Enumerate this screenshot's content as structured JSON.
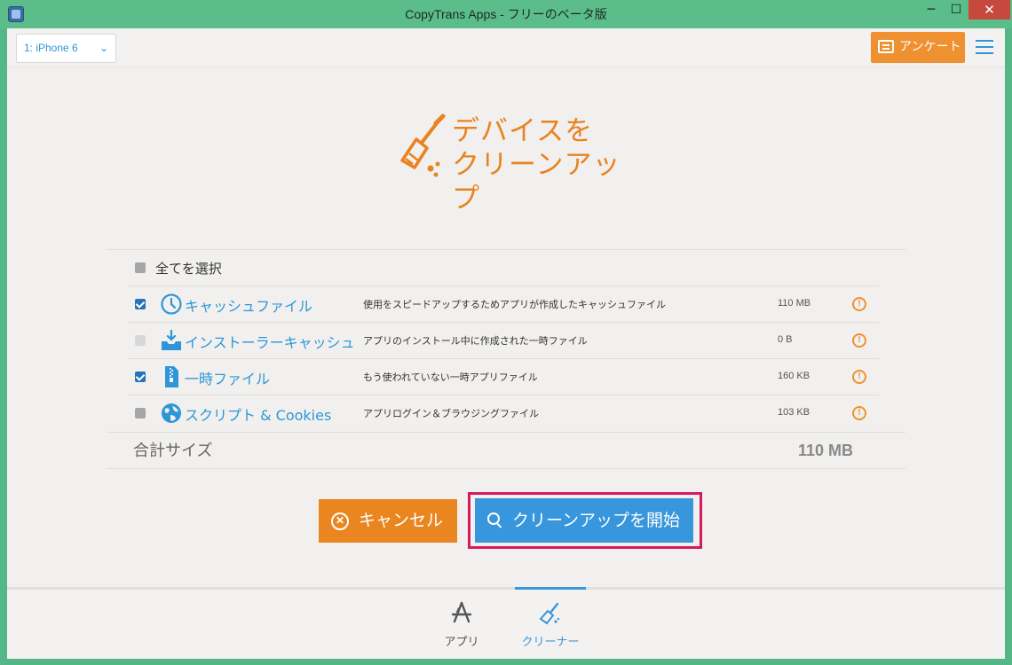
{
  "window": {
    "title": "CopyTrans Apps - フリーのベータ版",
    "minimize": "─",
    "maximize": "☐",
    "close": "✕"
  },
  "header": {
    "device": "1: iPhone 6",
    "survey_label": "アンケート"
  },
  "hero": {
    "line1": "デバイスを",
    "line2": "クリーンアップ"
  },
  "list": {
    "select_all": "全てを選択",
    "rows": [
      {
        "name": "キャッシュファイル",
        "desc": "使用をスピードアップするためアプリが作成したキャッシュファイル",
        "size": "110 MB",
        "checked": true,
        "icon": "clock-icon"
      },
      {
        "name": "インストーラーキャッシュ",
        "desc": "アプリのインストール中に作成された一時ファイル",
        "size": "0 B",
        "checked": false,
        "icon": "inbox-icon"
      },
      {
        "name": "一時ファイル",
        "desc": "もう使われていない一時アプリファイル",
        "size": "160 KB",
        "checked": true,
        "icon": "zip-file-icon"
      },
      {
        "name": "スクリプト & Cookies",
        "desc": "アプリログイン＆ブラウジングファイル",
        "size": "103 KB",
        "checked": false,
        "icon": "globe-icon"
      }
    ],
    "warn_symbol": "!",
    "total_label": "合計サイズ",
    "total_value": "110 MB"
  },
  "actions": {
    "cancel_label": "キャンセル",
    "cancel_symbol": "✕",
    "start_label": "クリーンアップを開始"
  },
  "tabs": {
    "apps_label": "アプリ",
    "cleaner_label": "クリーナー"
  },
  "colors": {
    "accent_orange": "#ea861f",
    "accent_blue": "#3796dc",
    "highlight": "#d7195f",
    "frame_green": "#53b886"
  }
}
